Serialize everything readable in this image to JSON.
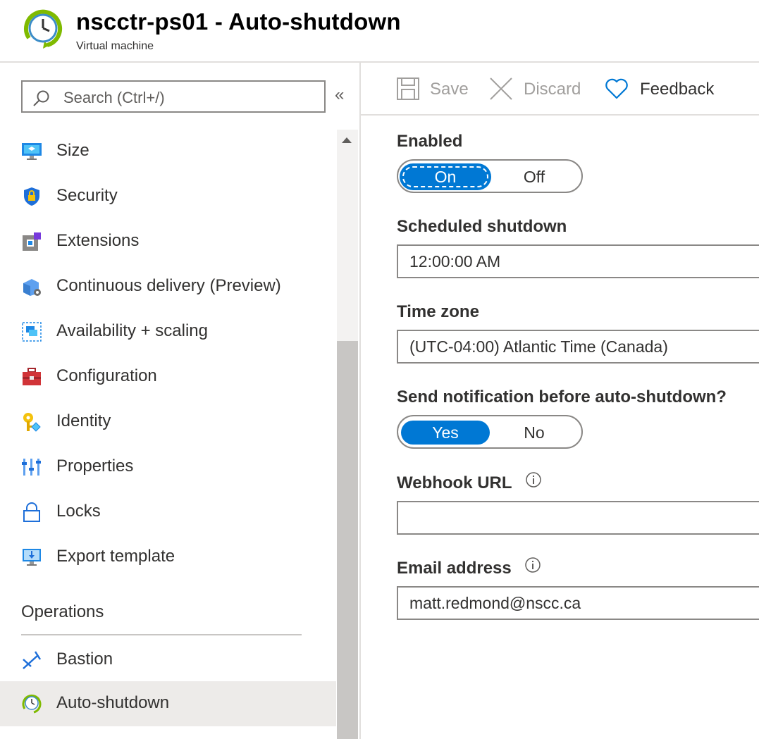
{
  "header": {
    "title": "nscctr-ps01 - Auto-shutdown",
    "subtitle": "Virtual machine"
  },
  "sidebar": {
    "search_placeholder": "Search (Ctrl+/)",
    "collapse_glyph": "«",
    "items": [
      {
        "label": "Size",
        "icon": "size-icon"
      },
      {
        "label": "Security",
        "icon": "shield-icon"
      },
      {
        "label": "Extensions",
        "icon": "extensions-icon"
      },
      {
        "label": "Continuous delivery (Preview)",
        "icon": "continuous-delivery-icon"
      },
      {
        "label": "Availability + scaling",
        "icon": "availability-icon"
      },
      {
        "label": "Configuration",
        "icon": "toolbox-icon"
      },
      {
        "label": "Identity",
        "icon": "key-icon"
      },
      {
        "label": "Properties",
        "icon": "properties-icon"
      },
      {
        "label": "Locks",
        "icon": "lock-icon"
      },
      {
        "label": "Export template",
        "icon": "export-template-icon"
      }
    ],
    "section_operations": "Operations",
    "operations_items": [
      {
        "label": "Bastion",
        "icon": "bastion-icon"
      },
      {
        "label": "Auto-shutdown",
        "icon": "clock-icon",
        "active": true
      }
    ]
  },
  "toolbar": {
    "save_label": "Save",
    "discard_label": "Discard",
    "feedback_label": "Feedback"
  },
  "form": {
    "enabled_label": "Enabled",
    "enabled_on": "On",
    "enabled_off": "Off",
    "enabled_value": "On",
    "scheduled_label": "Scheduled shutdown",
    "scheduled_value": "12:00:00 AM",
    "timezone_label": "Time zone",
    "timezone_value": "(UTC-04:00) Atlantic Time (Canada)",
    "notify_label": "Send notification before auto-shutdown?",
    "notify_yes": "Yes",
    "notify_no": "No",
    "notify_value": "Yes",
    "webhook_label": "Webhook URL",
    "webhook_value": "",
    "email_label": "Email address",
    "email_value": "matt.redmond@nscc.ca"
  },
  "colors": {
    "accent": "#0078d4",
    "border": "#8a8886",
    "active_nav": "#edebe9",
    "disabled_text": "#a19f9d"
  }
}
